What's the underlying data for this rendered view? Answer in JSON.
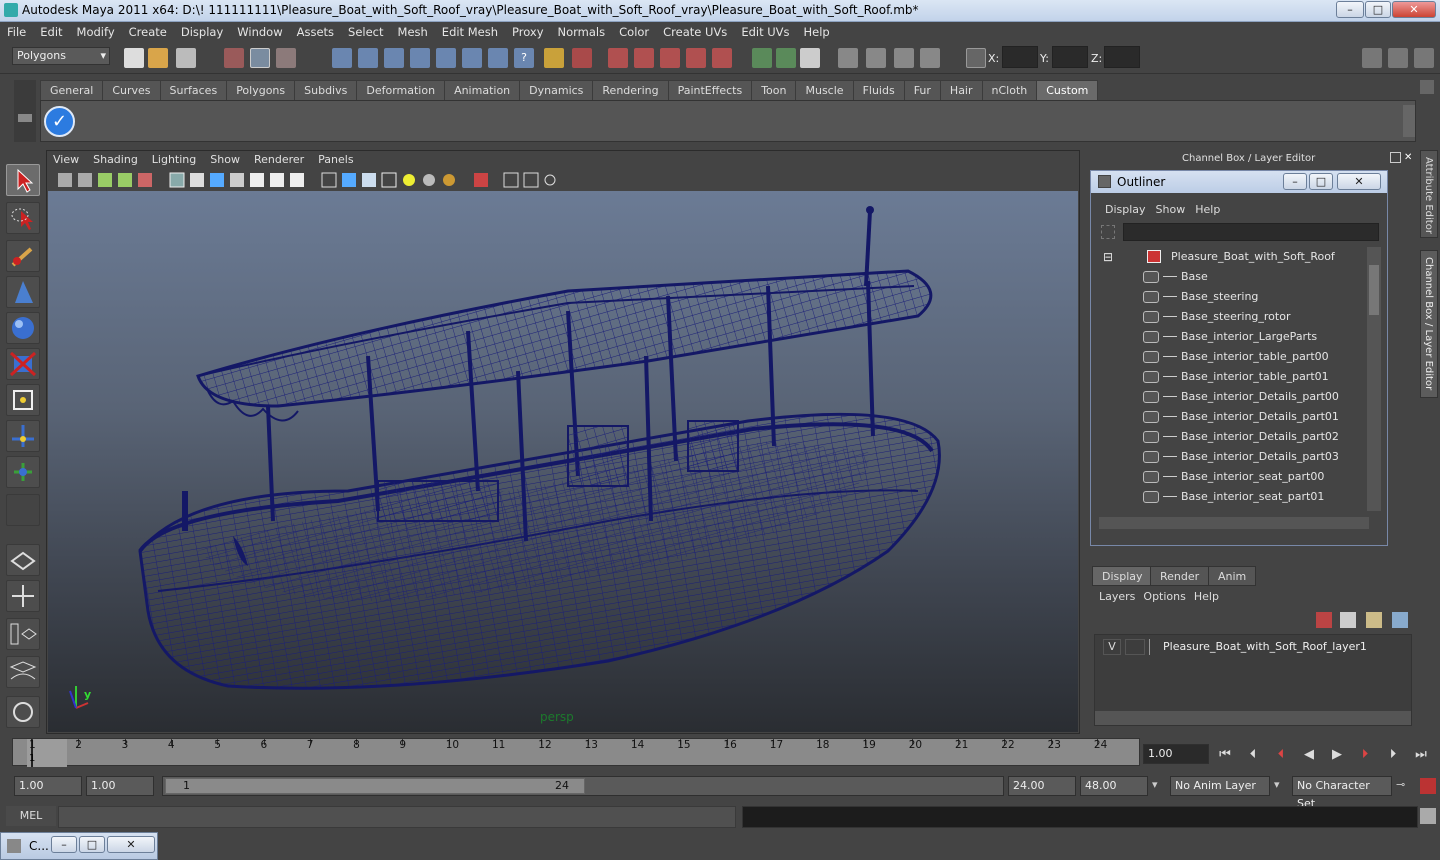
{
  "window": {
    "title": "Autodesk Maya 2011 x64: D:\\! 111111111\\Pleasure_Boat_with_Soft_Roof_vray\\Pleasure_Boat_with_Soft_Roof_vray\\Pleasure_Boat_with_Soft_Roof.mb*",
    "min": "–",
    "max": "□",
    "close": "✕"
  },
  "menu": [
    "File",
    "Edit",
    "Modify",
    "Create",
    "Display",
    "Window",
    "Assets",
    "Select",
    "Mesh",
    "Edit Mesh",
    "Proxy",
    "Normals",
    "Color",
    "Create UVs",
    "Edit UVs",
    "Help"
  ],
  "status": {
    "mode": "Polygons",
    "x_label": "X:",
    "y_label": "Y:",
    "z_label": "Z:"
  },
  "shelf_tabs": [
    "General",
    "Curves",
    "Surfaces",
    "Polygons",
    "Subdivs",
    "Deformation",
    "Animation",
    "Dynamics",
    "Rendering",
    "PaintEffects",
    "Toon",
    "Muscle",
    "Fluids",
    "Fur",
    "Hair",
    "nCloth",
    "Custom"
  ],
  "shelf_active": "Custom",
  "viewport": {
    "menu": [
      "View",
      "Shading",
      "Lighting",
      "Show",
      "Renderer",
      "Panels"
    ],
    "camera_label": "persp",
    "axis_y": "y"
  },
  "right_panel": {
    "header": "Channel Box / Layer Editor",
    "side_tabs": [
      "Attribute Editor",
      "Channel Box / Layer Editor"
    ]
  },
  "outliner": {
    "title": "Outliner",
    "menu": [
      "Display",
      "Show",
      "Help"
    ],
    "collapse": "⊟",
    "root": "Pleasure_Boat_with_Soft_Roof",
    "items": [
      "Base",
      "Base_steering",
      "Base_steering_rotor",
      "Base_interior_LargeParts",
      "Base_interior_table_part00",
      "Base_interior_table_part01",
      "Base_interior_Details_part00",
      "Base_interior_Details_part01",
      "Base_interior_Details_part02",
      "Base_interior_Details_part03",
      "Base_interior_seat_part00",
      "Base_interior_seat_part01"
    ]
  },
  "layer_editor": {
    "tabs": [
      "Display",
      "Render",
      "Anim"
    ],
    "active": "Display",
    "menu": [
      "Layers",
      "Options",
      "Help"
    ],
    "layer": {
      "visible": "V",
      "name": "Pleasure_Boat_with_Soft_Roof_layer1"
    }
  },
  "timeline": {
    "ticks": [
      "1",
      "2",
      "3",
      "4",
      "5",
      "6",
      "7",
      "8",
      "9",
      "10",
      "11",
      "12",
      "13",
      "14",
      "15",
      "16",
      "17",
      "18",
      "19",
      "20",
      "21",
      "22",
      "23",
      "24"
    ],
    "current_frame": "1",
    "current_time": "1.00"
  },
  "range": {
    "start": "1.00",
    "playback_start": "1.00",
    "slider_start": "1",
    "slider_end": "24",
    "playback_end": "24.00",
    "end": "48.00",
    "anim_layer": "No Anim Layer",
    "character_set": "No Character Set"
  },
  "cmdline": {
    "label": "MEL"
  },
  "taskbar": {
    "item": "C..."
  }
}
